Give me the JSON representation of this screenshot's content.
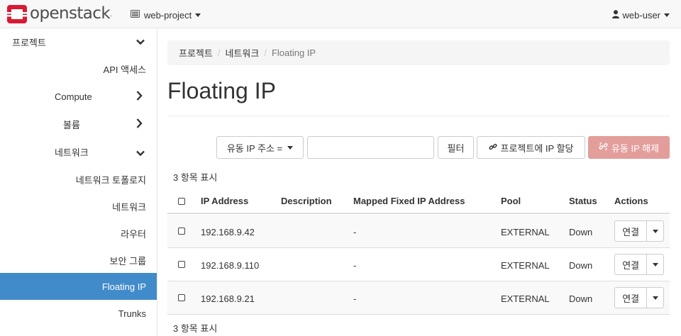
{
  "brand": {
    "name": "openstack",
    "reg_mark": "."
  },
  "topbar": {
    "project": "web-project",
    "user": "web-user"
  },
  "sidebar": {
    "items": [
      {
        "label": "프로젝트",
        "chevron": "down"
      },
      {
        "label": "API 액세스"
      },
      {
        "label": "Compute",
        "chevron": "right"
      },
      {
        "label": "볼륨",
        "chevron": "right"
      },
      {
        "label": "네트워크",
        "chevron": "down"
      },
      {
        "label": "네트워크 토폴로지"
      },
      {
        "label": "네트워크"
      },
      {
        "label": "라우터"
      },
      {
        "label": "보안 그룹"
      },
      {
        "label": "Floating IP",
        "active": true
      },
      {
        "label": "Trunks"
      }
    ]
  },
  "breadcrumb": {
    "items": [
      "프로젝트",
      "네트워크"
    ],
    "current": "Floating IP",
    "separator": "/"
  },
  "page": {
    "title": "Floating IP"
  },
  "toolbar": {
    "filter_field": "유동 IP 주소 =",
    "filter_value": "",
    "filter_button": "필터",
    "allocate_button": "프로젝트에 IP 할당",
    "release_button": "유동 IP 해제"
  },
  "table": {
    "count_label": "3 항목 표시",
    "columns": [
      "IP Address",
      "Description",
      "Mapped Fixed IP Address",
      "Pool",
      "Status",
      "Actions"
    ],
    "rows": [
      {
        "ip": "192.168.9.42",
        "description": "",
        "mapped": "-",
        "pool": "EXTERNAL",
        "status": "Down",
        "action": "연결"
      },
      {
        "ip": "192.168.9.110",
        "description": "",
        "mapped": "-",
        "pool": "EXTERNAL",
        "status": "Down",
        "action": "연결"
      },
      {
        "ip": "192.168.9.21",
        "description": "",
        "mapped": "-",
        "pool": "EXTERNAL",
        "status": "Down",
        "action": "연결"
      }
    ]
  },
  "colors": {
    "accent": "#428bca",
    "danger_disabled": "#e39e9c",
    "brand_red": "#da1a32"
  }
}
